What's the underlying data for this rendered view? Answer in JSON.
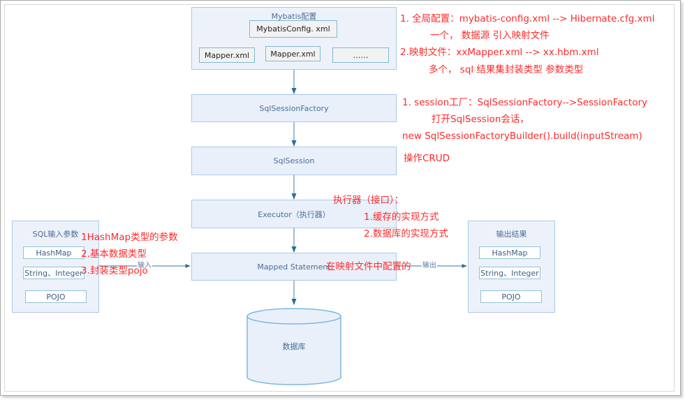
{
  "diagram": {
    "config_group": {
      "title": "Mybatis配置",
      "config_file": "MybatisConfig. xml",
      "mappers": [
        "Mapper.xml",
        "Mapper.xml",
        "……"
      ]
    },
    "flow": {
      "factory": "SqlSessionFactory",
      "session": "SqlSession",
      "executor": "Executor（执行器）",
      "mapped_statement": "Mapped Statement",
      "database": "数据库"
    },
    "input_group": {
      "title": "SQL输入参数",
      "items": [
        "HashMap",
        "String、Integer",
        "POJO"
      ],
      "edge_label": "输入"
    },
    "output_group": {
      "title": "输出结果",
      "items": [
        "HashMap",
        "String、Integer",
        "POJO"
      ],
      "edge_label": "输出"
    },
    "colors": {
      "annotation": "#ff2a2a",
      "box_fill": "#e9f0fa",
      "box_border": "#a9c8e8",
      "arrow": "#4f86b0"
    }
  },
  "annotations": {
    "config": [
      "1. 全局配置：mybatis-config.xml  --> Hibernate.cfg.xml",
      "一个， 数据源 引入映射文件",
      "2.映射文件：xxMapper.xml --> xx.hbm.xml",
      "多个， sql 结果集封装类型 参数类型"
    ],
    "factory": [
      "1. session工厂：SqlSessionFactory-->SessionFactory",
      "打开SqlSession会话，",
      "new SqlSessionFactoryBuilder().build(inputStream)"
    ],
    "session": "操作CRUD",
    "executor": [
      "执行器（接口）：",
      "1.缓存的实现方式",
      "2.数据库的实现方式"
    ],
    "input": [
      "1HashMap类型的参数",
      "2.基本数据类型",
      "3.封装类型pojo"
    ],
    "mapped_statement": "在映射文件中配置的"
  }
}
